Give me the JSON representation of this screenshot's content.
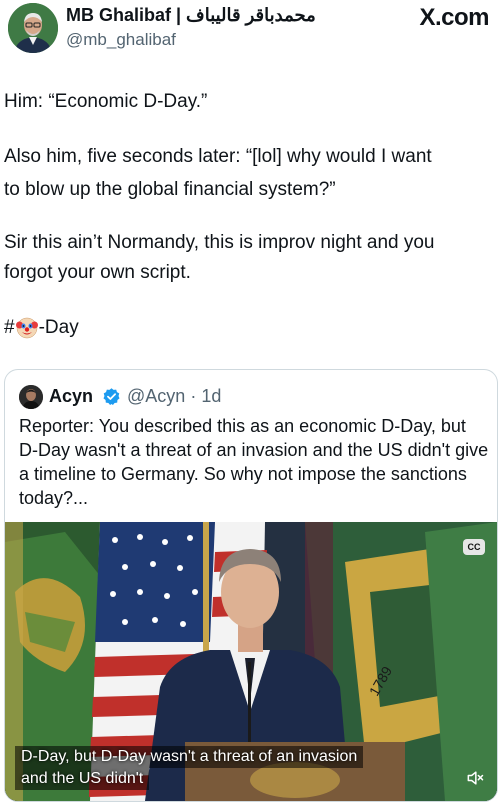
{
  "header": {
    "display_name": "MB Ghalibaf | محمدباقر قالیباف",
    "handle": "@mb_ghalibaf",
    "site": "X.com"
  },
  "post": {
    "p1": "Him: “Economic D-Day.”",
    "p2_line1": "Also him, five seconds later: “[lol] why would I want",
    "p2_line2": "to blow up the global financial system?”",
    "p3_line1": "Sir this ain’t Normandy, this is improv night and you",
    "p3_line2": "forgot your own script.",
    "hashtag_prefix": "#",
    "hashtag_suffix": "-Day",
    "hashtag_emoji": "clown-face-icon"
  },
  "quote": {
    "name": "Acyn",
    "handle": "@Acyn",
    "separator": "·",
    "time": "1d",
    "text": "Reporter: You described this as an economic D-Day, but D-Day wasn't a threat of an invasion and the US didn't give a timeline to Germany. So why not impose the sanctions today?...",
    "video": {
      "caption_line1": "D-Day, but D-Day wasn't a threat of an invasion",
      "caption_line2": "and the US didn't",
      "cc_label": "CC",
      "year_on_flag": "1789"
    }
  },
  "colors": {
    "text": "#0f1419",
    "secondary": "#536471",
    "verified": "#1d9bf0",
    "border": "#cfd9de"
  }
}
